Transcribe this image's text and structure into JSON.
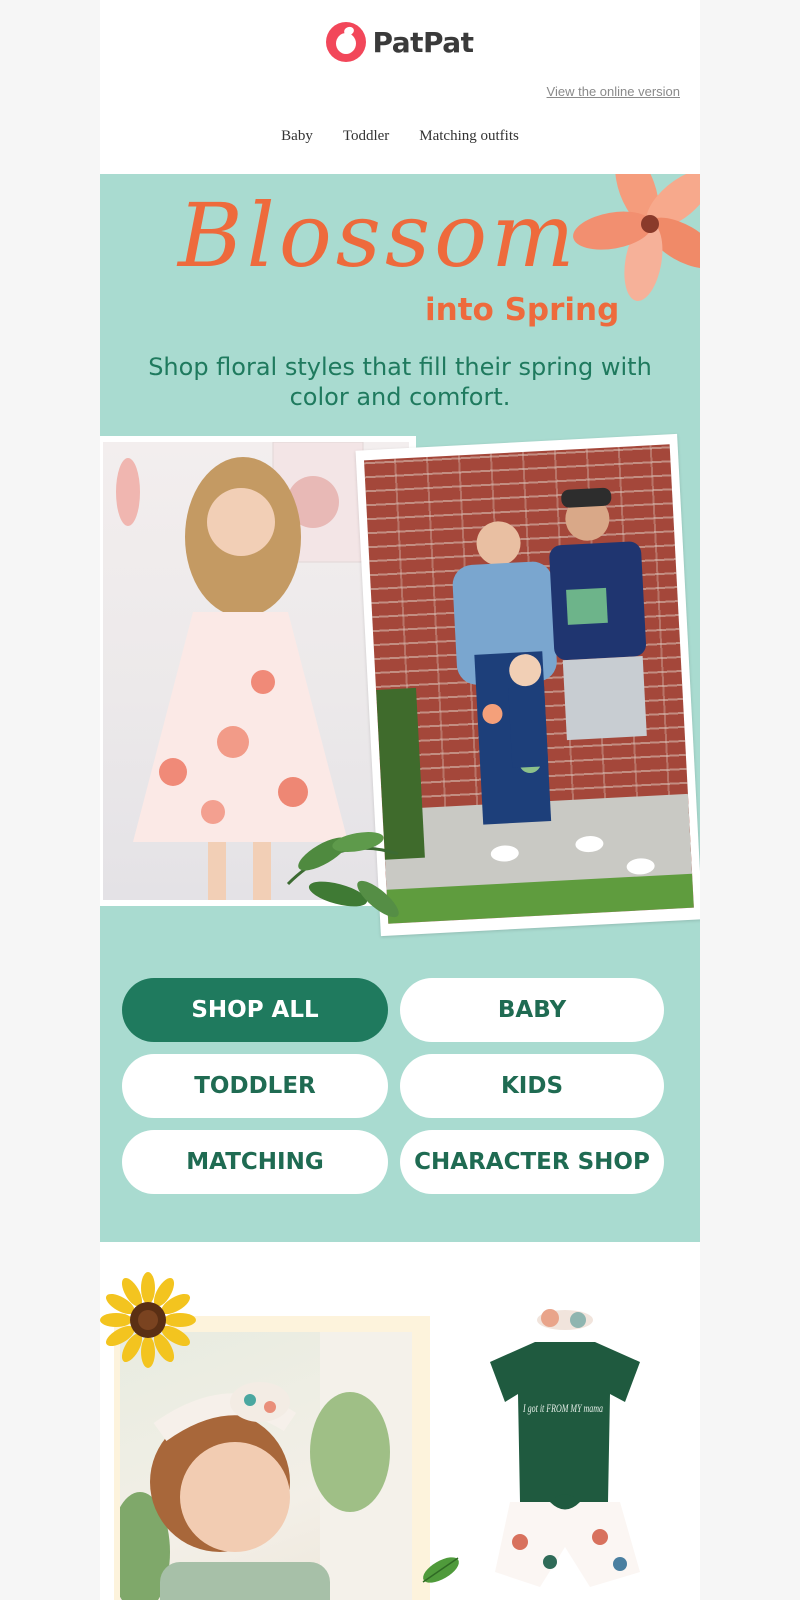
{
  "header": {
    "brand": "PatPat",
    "view_online": "View the online version",
    "nav": [
      "Baby",
      "Toddler",
      "Matching outfits"
    ]
  },
  "hero": {
    "title_script": "Blossom",
    "title_bold": "into Spring",
    "subtitle": "Shop floral styles that fill their spring with color and comfort.",
    "bg_color": "#a9dbd0",
    "accent_color": "#ee6a3c",
    "text_color": "#1f7a5e"
  },
  "cta_buttons": [
    "SHOP ALL",
    "BABY",
    "TODDLER",
    "KIDS",
    "MATCHING",
    "CHARACTER SHOP"
  ],
  "onesie_text": "I got it FROM MY mama"
}
